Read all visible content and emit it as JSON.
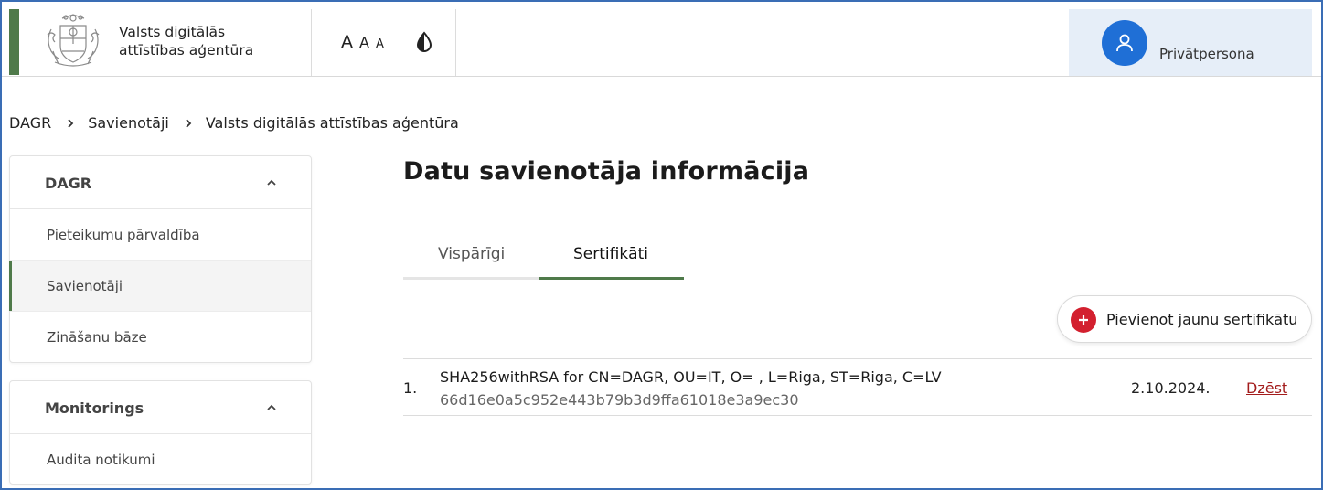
{
  "header": {
    "agency_line1": "Valsts digitālās",
    "agency_line2": "attīstības aģentūra",
    "font_large": "A",
    "font_medium": "A",
    "font_small": "A",
    "user_label": "Privātpersona",
    "brand_color": "#4f7a4a",
    "avatar_color": "#1f6fd6"
  },
  "breadcrumb": {
    "items": [
      "DAGR",
      "Savienotāji",
      "Valsts digitālās attīstības aģentūra"
    ]
  },
  "sidebar": {
    "groups": [
      {
        "title": "DAGR",
        "items": [
          "Pieteikumu pārvaldība",
          "Savienotāji",
          "Zināšanu bāze"
        ],
        "active_item": "Savienotāji"
      },
      {
        "title": "Monitorings",
        "items": [
          "Audita notikumi"
        ]
      }
    ]
  },
  "main": {
    "title": "Datu savienotāja informācija",
    "tabs": [
      {
        "label": "Vispārīgi",
        "active": false
      },
      {
        "label": "Sertifikāti",
        "active": true
      }
    ],
    "add_button_label": "Pievienot jaunu sertifikātu",
    "certificates": [
      {
        "number": "1.",
        "subject": "SHA256withRSA for CN=DAGR, OU=IT, O=            , L=Riga, ST=Riga, C=LV",
        "hash": "66d16e0a5c952e443b79b3d9ffa61018e3a9ec30",
        "date": "2.10.2024.",
        "delete_label": "Dzēst"
      }
    ]
  }
}
